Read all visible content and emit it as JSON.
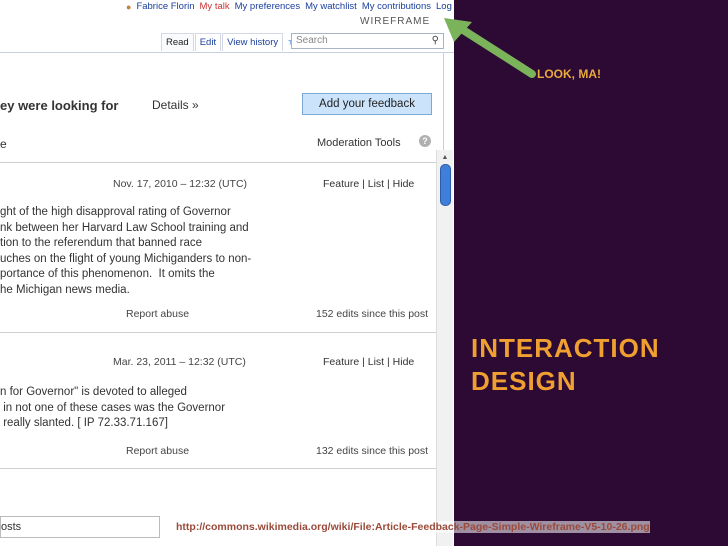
{
  "userbar": {
    "user": "Fabrice Florin",
    "talk": "My talk",
    "preferences": "My preferences",
    "watchlist": "My watchlist",
    "contributions": "My contributions",
    "logout": "Log out"
  },
  "wireframe_label": "WIREFRAME",
  "tabs": {
    "read": "Read",
    "edit": "Edit",
    "history": "View history"
  },
  "search": {
    "placeholder": "Search"
  },
  "heading": "ey were looking for",
  "details": "Details  »",
  "feedback_button": "Add your feedback",
  "list_header": "e",
  "moderation_tools": "Moderation Tools",
  "help": "?",
  "posts": [
    {
      "date": "Nov. 17, 2010 – 12:32 (UTC)",
      "actions": "Feature | List | Hide",
      "body": "ght of the high disapproval rating of Governor\nnk between her Harvard Law School training and\ntion to the referendum that banned race\nuches on the flight of young Michiganders to non-\nportance of this phenomenon.  It omits the\nhe Michigan news media.",
      "report": "Report abuse",
      "edits": "152 edits since this post"
    },
    {
      "date": "Mar. 23, 2011 – 12:32 (UTC)",
      "actions": "Feature | List | Hide",
      "body": "n for Governor\" is devoted to alleged\n in not one of these cases was the Governor\n really slanted. [ IP 72.33.71.167]",
      "report": "Report abuse",
      "edits": "132 edits since this post"
    }
  ],
  "bottom_field": "osts",
  "source_url": "http://commons.wikimedia.org/wiki/File:Article-Feedback-Page-Simple-Wireframe-V5-10-26.png",
  "annotations": {
    "look": "LOOK, MA!",
    "title_line1": "INTERACTION",
    "title_line2": "DESIGN"
  },
  "colors": {
    "background": "#2c0a33",
    "accent": "#f0a030",
    "arrow": "#7ab35a"
  }
}
